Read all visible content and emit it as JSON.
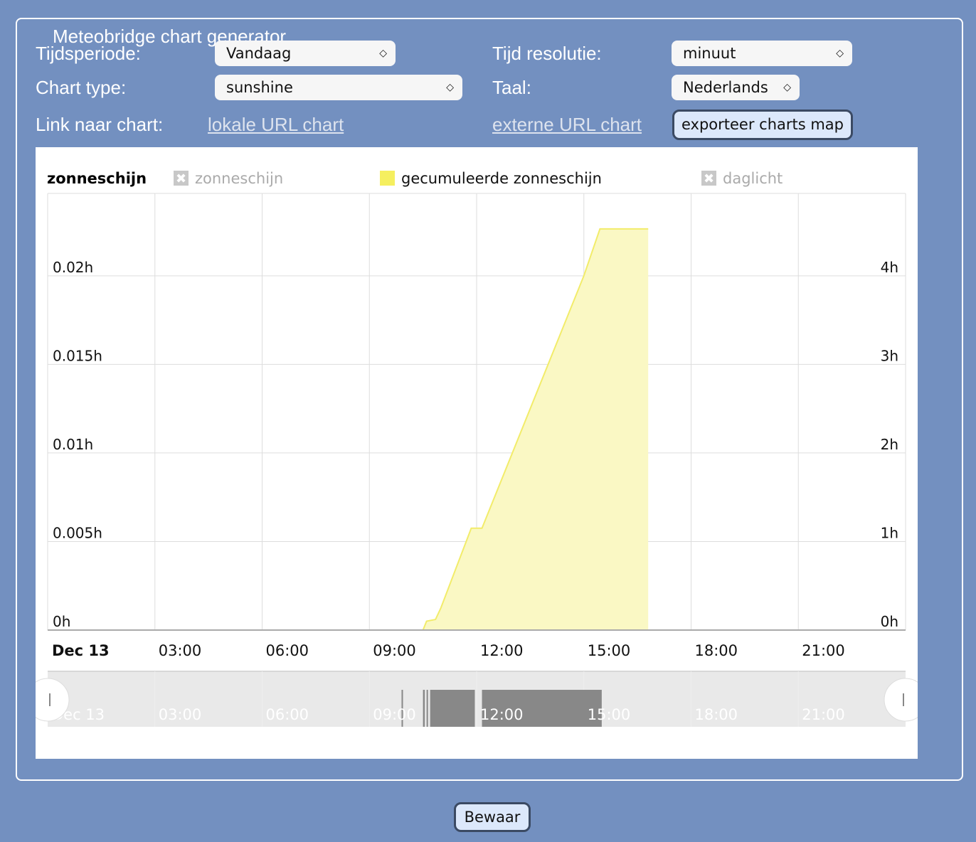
{
  "title": "Meteobridge chart generator",
  "form": {
    "period_label": "Tijdsperiode:",
    "period_value": "Vandaag",
    "resolution_label": "Tijd resolutie:",
    "resolution_value": "minuut",
    "charttype_label": "Chart type:",
    "charttype_value": "sunshine",
    "language_label": "Taal:",
    "language_value": "Nederlands",
    "link_label": "Link naar chart:",
    "local_link": "lokale URL chart",
    "external_link": "externe URL chart",
    "export_button": "exporteer charts map"
  },
  "save_button": "Bewaar",
  "chart_data": {
    "type": "area",
    "title": "zonneschijn",
    "legend": [
      {
        "name": "zonneschijn",
        "enabled": false
      },
      {
        "name": "gecumuleerde zonneschijn",
        "enabled": true,
        "color": "#f5ef5f"
      },
      {
        "name": "daglicht",
        "enabled": false
      }
    ],
    "x_ticks": [
      "Dec 13",
      "03:00",
      "06:00",
      "09:00",
      "12:00",
      "15:00",
      "18:00",
      "21:00"
    ],
    "xlim_hours": [
      0,
      24
    ],
    "y_left_ticks": [
      "0h",
      "0.005h",
      "0.01h",
      "0.015h",
      "0.02h"
    ],
    "y_right_ticks": [
      "0h",
      "1h",
      "2h",
      "3h",
      "4h"
    ],
    "ylim_right_hours": [
      0,
      4.93
    ],
    "series": [
      {
        "name": "gecumuleerde zonneschijn",
        "unit": "h",
        "points": [
          [
            9.9,
            0
          ],
          [
            10.5,
            0
          ],
          [
            10.6,
            0.1
          ],
          [
            10.85,
            0.12
          ],
          [
            11.0,
            0.25
          ],
          [
            11.85,
            1.15
          ],
          [
            12.15,
            1.15
          ],
          [
            15.0,
            4.0
          ],
          [
            15.45,
            4.53
          ],
          [
            16.8,
            4.53
          ]
        ]
      }
    ],
    "navigator_sunshine_intervals": [
      [
        9.9,
        9.92
      ],
      [
        10.5,
        10.55
      ],
      [
        10.6,
        10.62
      ],
      [
        10.7,
        11.95
      ],
      [
        12.15,
        15.5
      ]
    ]
  }
}
